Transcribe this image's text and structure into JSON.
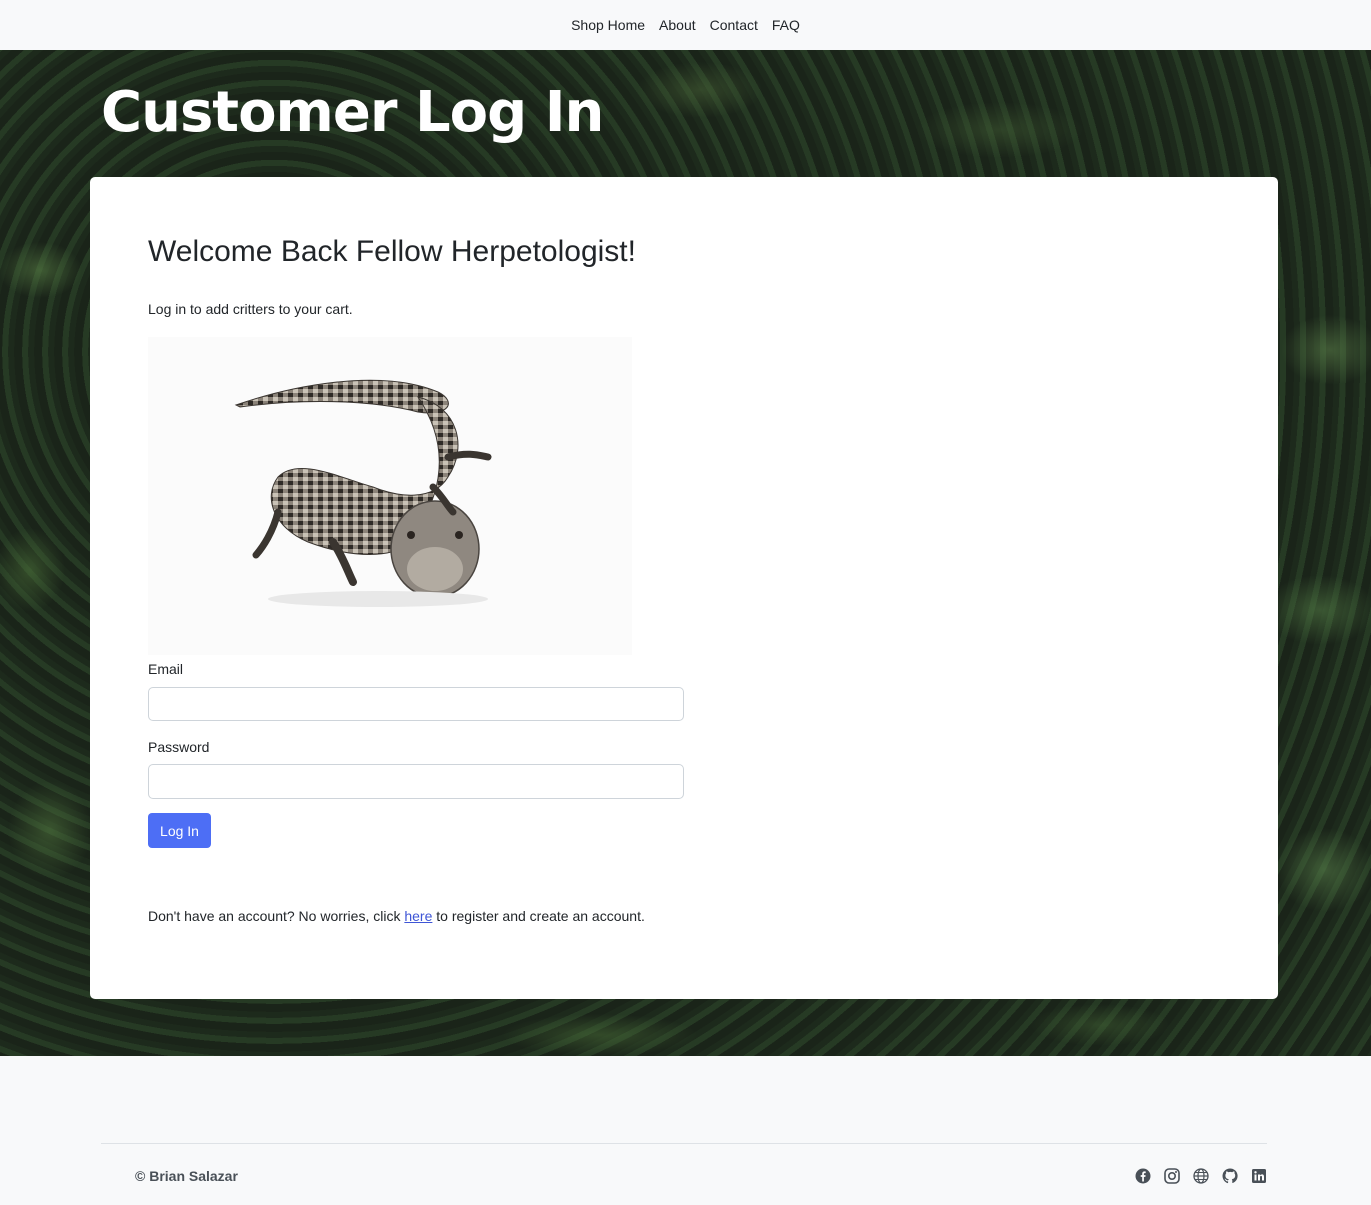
{
  "nav": {
    "items": [
      "Shop Home",
      "About",
      "Contact",
      "FAQ"
    ]
  },
  "hero": {
    "title": "Customer Log In"
  },
  "card": {
    "heading": "Welcome Back Fellow Herpetologist!",
    "subtext": "Log in to add critters to your cart.",
    "image_icon": "blue-tongue-skink-photo",
    "email_label": "Email",
    "email_value": "",
    "password_label": "Password",
    "password_value": "",
    "login_button": "Log In",
    "register_prefix": "Don't have an account? No worries, click ",
    "register_link": "here",
    "register_suffix": " to register and create an account."
  },
  "footer": {
    "copyright": "© Brian Salazar",
    "social_icons": [
      "facebook-icon",
      "instagram-icon",
      "globe-icon",
      "github-icon",
      "linkedin-icon"
    ]
  },
  "colors": {
    "accent": "#4d6ef5",
    "link": "#3e55d6",
    "page_bg": "#f8f9fa"
  }
}
